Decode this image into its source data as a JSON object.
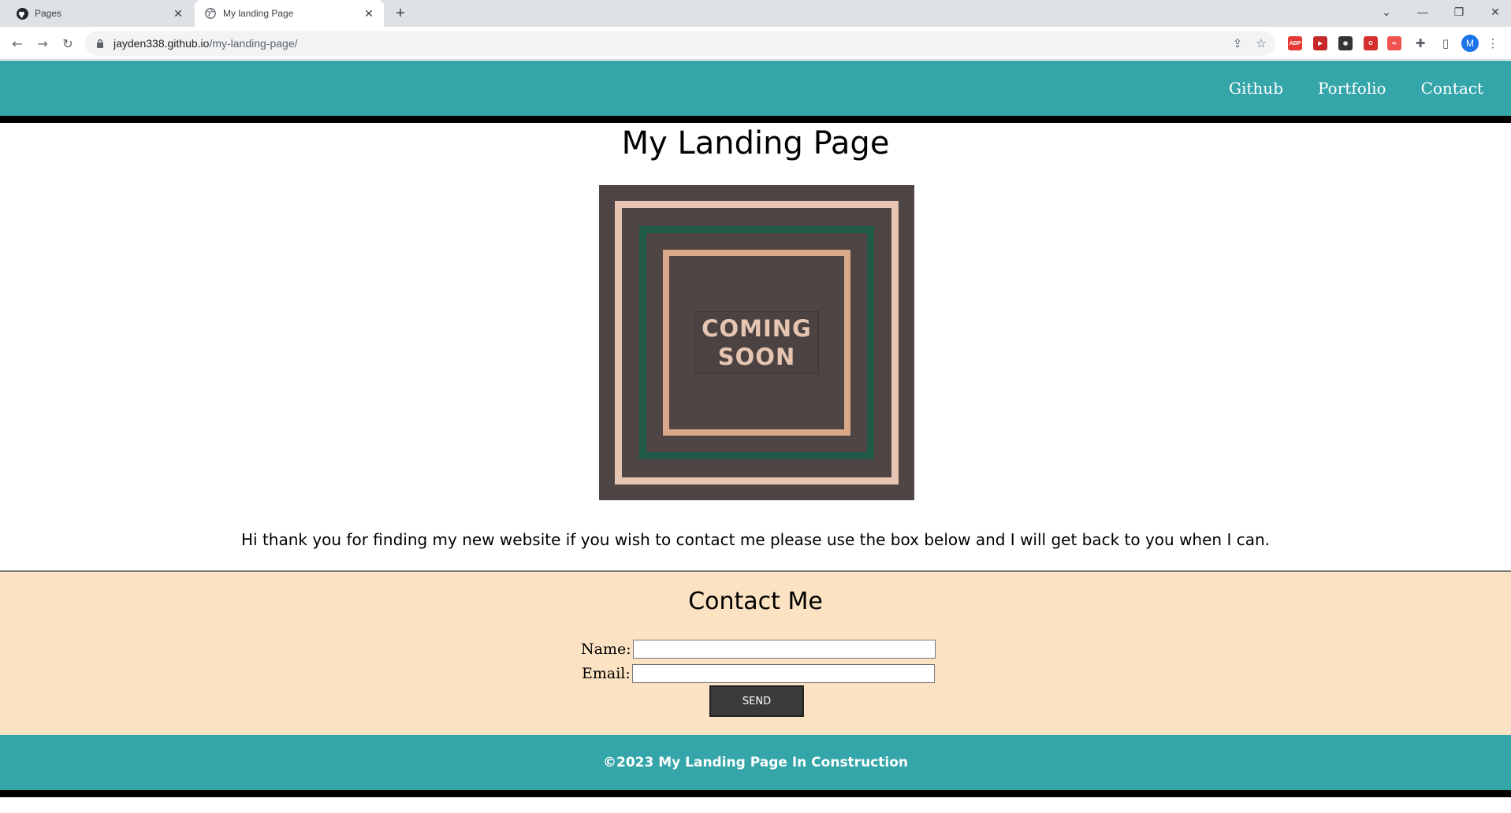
{
  "browser": {
    "tabs": [
      {
        "title": "Pages",
        "icon": "github-icon"
      },
      {
        "title": "My landing Page",
        "icon": "globe-icon"
      }
    ],
    "new_tab_label": "+",
    "url_host": "jayden338.github.io",
    "url_path": "/my-landing-page/",
    "extensions": [
      {
        "name": "adblock-plus-icon",
        "label": "ABP",
        "color": "#e53935"
      },
      {
        "name": "video-extension-icon",
        "label": "▶",
        "color": "#c62828"
      },
      {
        "name": "spy-extension-icon",
        "label": "◉",
        "color": "#333333"
      },
      {
        "name": "opera-extension-icon",
        "label": "O",
        "color": "#d32f2f"
      },
      {
        "name": "arrow-extension-icon",
        "label": "➪",
        "color": "#ef5350"
      }
    ],
    "profile_initial": "M"
  },
  "site": {
    "nav": [
      "Github",
      "Portfolio",
      "Contact"
    ],
    "title": "My Landing Page",
    "hero": {
      "line1": "COMING",
      "line2": "SOON",
      "colors": {
        "background": "#4f4544",
        "outer_frame": "#e6c6b2",
        "middle_frame": "#1f5a49",
        "inner_frame": "#d9a98a",
        "text": "#e6c6b2"
      }
    },
    "intro": "Hi thank you for finding my new website if you wish to contact me please use the box below and I will get back to you when I can.",
    "contact": {
      "heading": "Contact Me",
      "name_label": "Name:",
      "email_label": "Email:",
      "send_label": "SEND"
    },
    "footer": "©2023 My Landing Page In Construction",
    "colors": {
      "header": "#34a5a8",
      "contact_bg": "#fbe2c2",
      "bar": "#000000"
    }
  }
}
